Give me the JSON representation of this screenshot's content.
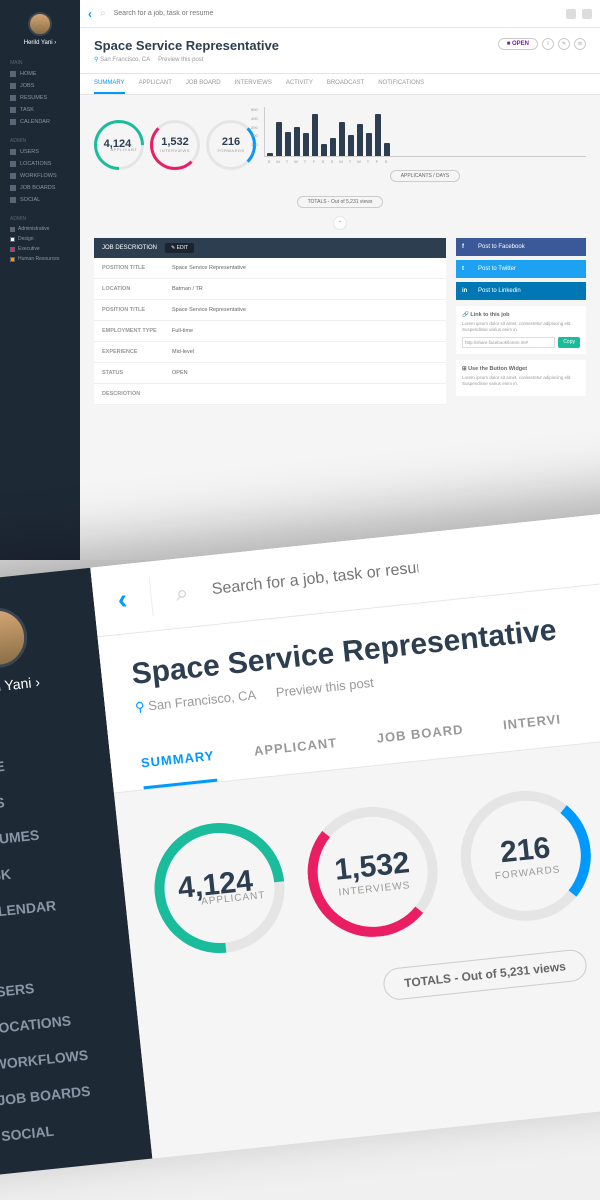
{
  "user": {
    "name": "Herild Yani"
  },
  "search": {
    "placeholder": "Search for a job, task or resume"
  },
  "nav": {
    "main_header": "Main",
    "admin_header": "Admin",
    "admin2_header": "Admin",
    "main": [
      {
        "label": "HOME"
      },
      {
        "label": "JOBS"
      },
      {
        "label": "RESUMES"
      },
      {
        "label": "TASK"
      },
      {
        "label": "CALENDAR"
      }
    ],
    "admin": [
      {
        "label": "USERS"
      },
      {
        "label": "LOCATIONS"
      },
      {
        "label": "WORKFLOWS"
      },
      {
        "label": "JOB BOARDS"
      },
      {
        "label": "SOCIAL"
      }
    ],
    "checkboxes": [
      {
        "label": "Administrative"
      },
      {
        "label": "Design"
      },
      {
        "label": "Executive"
      },
      {
        "label": "Human Resources"
      }
    ]
  },
  "job": {
    "title": "Space Service Representative",
    "location": "San Francisco, CA",
    "preview": "Preview this post",
    "status_badge": "OPEN"
  },
  "tabs": [
    {
      "label": "SUMMARY"
    },
    {
      "label": "APPLICANT"
    },
    {
      "label": "JOB BOARD"
    },
    {
      "label": "INTERVIEWS"
    },
    {
      "label": "ACTIVITY"
    },
    {
      "label": "BROADCAST"
    },
    {
      "label": "NOTIFICATIONS"
    }
  ],
  "stats": [
    {
      "value": "4,124",
      "label": "APPLICANT"
    },
    {
      "value": "1,532",
      "label": "INTERVIEWS"
    },
    {
      "value": "216",
      "label": "FORWARDS"
    }
  ],
  "totals": "TOTALS - Out of 5,231 views",
  "chart_data": {
    "type": "bar",
    "title": "APPLICANTS / DAYS",
    "ylabel": "",
    "ylim": [
      0,
      500
    ],
    "y_ticks": [
      500,
      400,
      300,
      200,
      100,
      0
    ],
    "categories": [
      "S",
      "M",
      "T",
      "W",
      "T",
      "F",
      "S",
      "S",
      "M",
      "T",
      "W",
      "T",
      "F",
      "S"
    ],
    "values": [
      30,
      350,
      240,
      300,
      230,
      430,
      120,
      180,
      350,
      210,
      330,
      230,
      430,
      130
    ]
  },
  "table": {
    "header": "JOB DESCRIOTION",
    "edit": "EDIT",
    "rows": [
      {
        "label": "POSITION TITLE",
        "value": "Space Service Representative"
      },
      {
        "label": "LOCATION",
        "value": "Batman / TR"
      },
      {
        "label": "POSITION TITLE",
        "value": "Space Service Representative"
      },
      {
        "label": "EMPLOYMENT TYPE",
        "value": "Full-time"
      },
      {
        "label": "EXPERIENCE",
        "value": "Mid-level"
      },
      {
        "label": "STATUS",
        "value": "OPEN"
      },
      {
        "label": "DESCRIOTION",
        "value": ""
      }
    ]
  },
  "social": {
    "fb": "Post to Facebook",
    "tw": "Post to Twitter",
    "li": "Post to Linkedin",
    "link_title": "Link to this job",
    "link_desc": "Lorem ipsum dolor sit amet, consectetur adipiscing elit. Suspendisse varius enim in.",
    "link_url": "http://share.facebook/lorem.im#",
    "copy": "Copy",
    "widget_title": "Use the Button Widget",
    "widget_desc": "Lorem ipsum dolor sit amet, consectetur adipiscing elit. Suspendisse varius enim in."
  },
  "zoom_tabs": [
    {
      "label": "SUMMARY"
    },
    {
      "label": "APPLICANT"
    },
    {
      "label": "JOB BOARD"
    },
    {
      "label": "INTERVI"
    }
  ]
}
